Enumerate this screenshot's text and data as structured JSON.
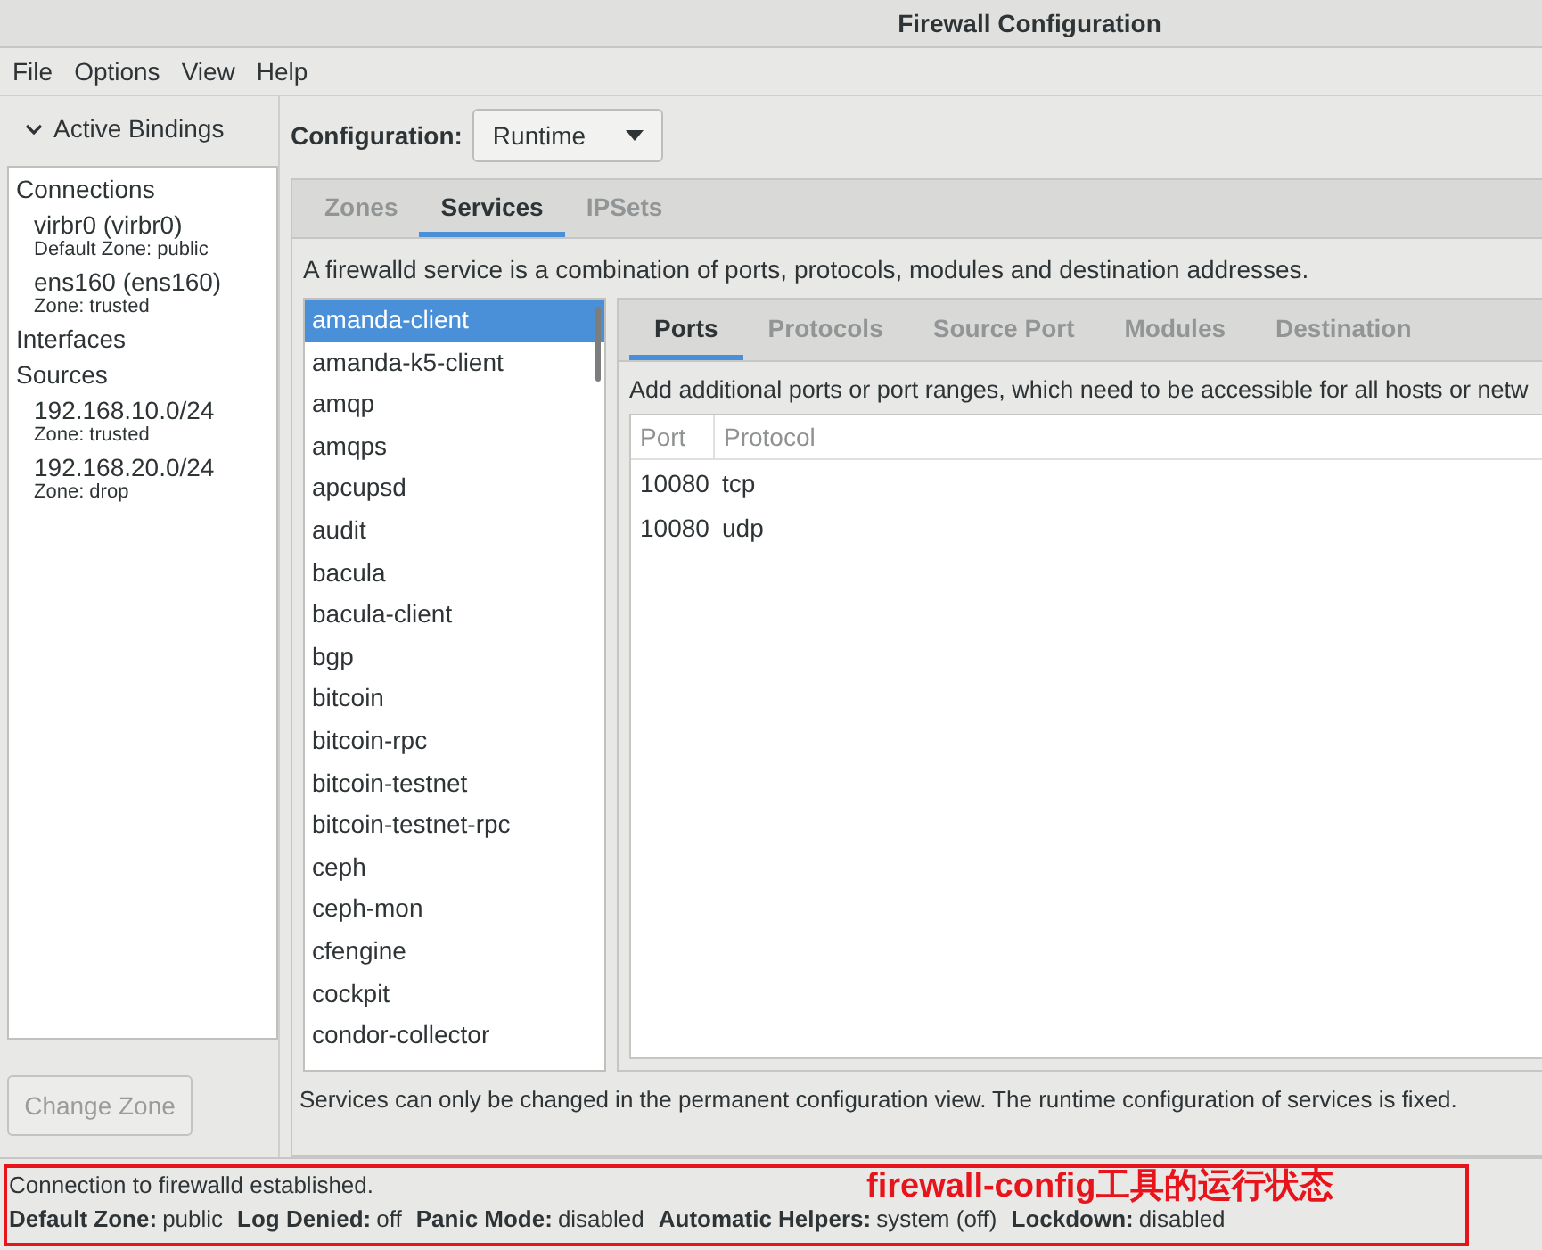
{
  "window": {
    "title": "Firewall Configuration"
  },
  "menu": [
    "File",
    "Options",
    "View",
    "Help"
  ],
  "bindings": {
    "title": "Active Bindings",
    "expanded": true,
    "sections": [
      {
        "title": "Connections",
        "items": [
          {
            "name": "virbr0 (virbr0)",
            "zone": "Default Zone: public"
          },
          {
            "name": "ens160 (ens160)",
            "zone": "Zone: trusted"
          }
        ]
      },
      {
        "title": "Interfaces"
      },
      {
        "title": "Sources",
        "items": [
          {
            "name": "192.168.10.0/24",
            "zone": "Zone: trusted"
          },
          {
            "name": "192.168.20.0/24",
            "zone": "Zone: drop"
          }
        ]
      }
    ],
    "button": {
      "label": "Change Zone",
      "disabled": true
    }
  },
  "configuration": {
    "label": "Configuration:",
    "value": "Runtime"
  },
  "tabs": [
    {
      "label": "Zones",
      "selected": false
    },
    {
      "label": "Services",
      "selected": true
    },
    {
      "label": "IPSets",
      "selected": false
    }
  ],
  "description": "A firewalld service is a combination of ports, protocols, modules and destination addresses.",
  "services": [
    {
      "name": "amanda-client",
      "selected": true
    },
    {
      "name": "amanda-k5-client",
      "selected": false
    },
    {
      "name": "amqp",
      "selected": false
    },
    {
      "name": "amqps",
      "selected": false
    },
    {
      "name": "apcupsd",
      "selected": false
    },
    {
      "name": "audit",
      "selected": false
    },
    {
      "name": "bacula",
      "selected": false
    },
    {
      "name": "bacula-client",
      "selected": false
    },
    {
      "name": "bgp",
      "selected": false
    },
    {
      "name": "bitcoin",
      "selected": false
    },
    {
      "name": "bitcoin-rpc",
      "selected": false
    },
    {
      "name": "bitcoin-testnet",
      "selected": false
    },
    {
      "name": "bitcoin-testnet-rpc",
      "selected": false
    },
    {
      "name": "ceph",
      "selected": false
    },
    {
      "name": "ceph-mon",
      "selected": false
    },
    {
      "name": "cfengine",
      "selected": false
    },
    {
      "name": "cockpit",
      "selected": false
    },
    {
      "name": "condor-collector",
      "selected": false
    }
  ],
  "detail_tabs": [
    {
      "label": "Ports",
      "selected": true
    },
    {
      "label": "Protocols",
      "selected": false
    },
    {
      "label": "Source Port",
      "selected": false
    },
    {
      "label": "Modules",
      "selected": false
    },
    {
      "label": "Destination",
      "selected": false
    }
  ],
  "ports_hint": "Add additional ports or port ranges, which need to be accessible for all hosts or netw",
  "table": {
    "columns": [
      "Port",
      "Protocol"
    ],
    "rows": [
      [
        "10080",
        "tcp"
      ],
      [
        "10080",
        "udp"
      ]
    ]
  },
  "footer_note": "Services can only be changed in the permanent configuration view. The runtime configuration of services is fixed.",
  "status_bar": {
    "message": "Connection to firewalld established.",
    "items": [
      {
        "label": "Default Zone:",
        "value": "public"
      },
      {
        "label": "Log Denied:",
        "value": "off"
      },
      {
        "label": "Panic Mode:",
        "value": "disabled"
      },
      {
        "label": "Automatic Helpers:",
        "value": "system (off)"
      },
      {
        "label": "Lockdown:",
        "value": "disabled"
      }
    ]
  },
  "annotation": {
    "text": "firewall-config工具的运行状态"
  }
}
